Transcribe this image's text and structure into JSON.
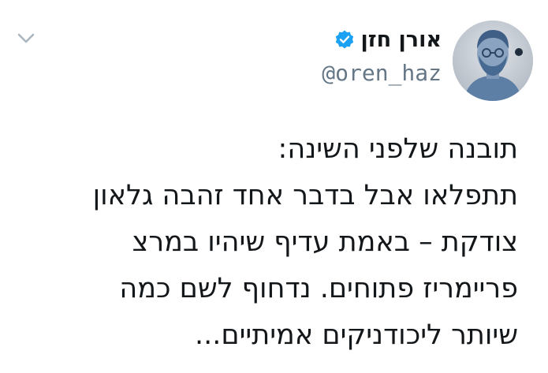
{
  "tweet": {
    "author": {
      "display_name": "אורן חזן",
      "handle": "@oren_haz",
      "verified": true
    },
    "text_lines": [
      "תובנה שלפני השינה:",
      "תתפלאו אבל בדבר אחד זהבה גלאון",
      "צודקת – באמת עדיף שיהיו במרצ",
      "פריימריז פתוחים. נדחוף לשם כמה",
      "שיותר ליכודניקים אמיתיים..."
    ]
  },
  "colors": {
    "verified_blue": "#1da1f2",
    "handle_gray": "#657786",
    "text": "#14171a",
    "chevron": "#aab8c2"
  },
  "icons": {
    "menu": "chevron-down-icon",
    "verified": "verified-badge-icon"
  }
}
